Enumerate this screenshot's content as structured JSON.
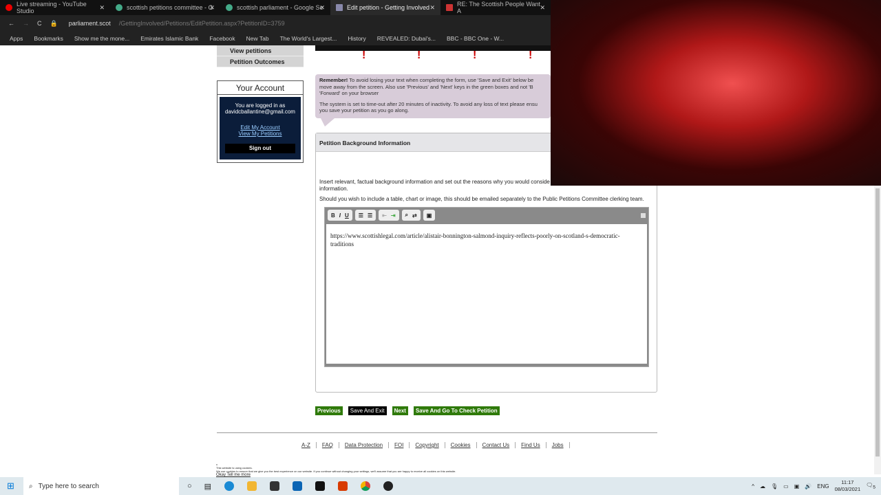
{
  "browser": {
    "tabs": [
      {
        "title": "Live streaming - YouTube Studio",
        "color": "#e00"
      },
      {
        "title": "scottish petitions committee - G",
        "color": "#4a8"
      },
      {
        "title": "scottish parliament - Google Se",
        "color": "#4a8"
      },
      {
        "title": "Edit petition - Getting Involved",
        "color": "#88a",
        "active": true
      },
      {
        "title": "RE: The Scottish People Want A",
        "color": "#c33"
      }
    ],
    "url_host": "parliament.scot",
    "url_path": "/GettingInvolved/Petitions/EditPetition.aspx?PetitionID=3759",
    "bookmarks": [
      "Apps",
      "Bookmarks",
      "Show me the mone...",
      "Emirates Islamic Bank",
      "Facebook",
      "New Tab",
      "The World's Largest...",
      "History",
      "REVEALED: Dubai's...",
      "BBC - BBC One - W..."
    ]
  },
  "nav": {
    "items": [
      "View petitions",
      "Petition Outcomes"
    ]
  },
  "account": {
    "title": "Your Account",
    "logged_in_as": "You are logged in as",
    "email": "davidcballantine@gmail.com",
    "edit": "Edit My Account",
    "view": "View My Petitions",
    "sign_out": "Sign out"
  },
  "remember": {
    "p1_bold": "Remember!",
    "p1": " To avoid losing your text when completing the form, use 'Save and Exit' below be move away from the screen. Also use 'Previous' and 'Next' keys in the green boxes and not 'B 'Forward' on your browser",
    "p2": "The system is set to time-out after 20 minutes of inactivity. To avoid any loss of text please ensu you save your petition as you go along."
  },
  "panel": {
    "title": "Petition Background Information",
    "help1": "Insert relevant, factual background information and set out the reasons why you would conside be necessary. Select Help for more information.",
    "help2": "Should you wish to include a table, chart or image, this should be emailed separately to the Public Petitions Committee clerking team.",
    "toolbar": {
      "bold": "B",
      "italic": "I",
      "underline": "U"
    },
    "editor_text": "https://www.scottishlegal.com/article/alistair-bonnington-salmond-inquiry-reflects-poorly-on-scotland-s-democratic-traditions"
  },
  "buttons": {
    "previous": "Previous",
    "save_exit": "Save And Exit",
    "next": "Next",
    "save_check": "Save And Go To Check Petition"
  },
  "footer": [
    "A-Z",
    "FAQ",
    "Data Protection",
    "FOI",
    "Copyright",
    "Cookies",
    "Contact Us",
    "Find Us",
    "Jobs"
  ],
  "cookie": {
    "x": "x",
    "line1": "This website is using cookies.",
    "line2": "We use cookies to ensure that we give you the best experience on our website. If you continue without changing your settings, we'll assume that you are happy to receive all cookies on this website.",
    "links": "Okay Tell me more"
  },
  "taskbar": {
    "search_placeholder": "Type here to search",
    "lang": "ENG",
    "time": "11:17",
    "date": "08/03/2021",
    "notifications": "5"
  }
}
